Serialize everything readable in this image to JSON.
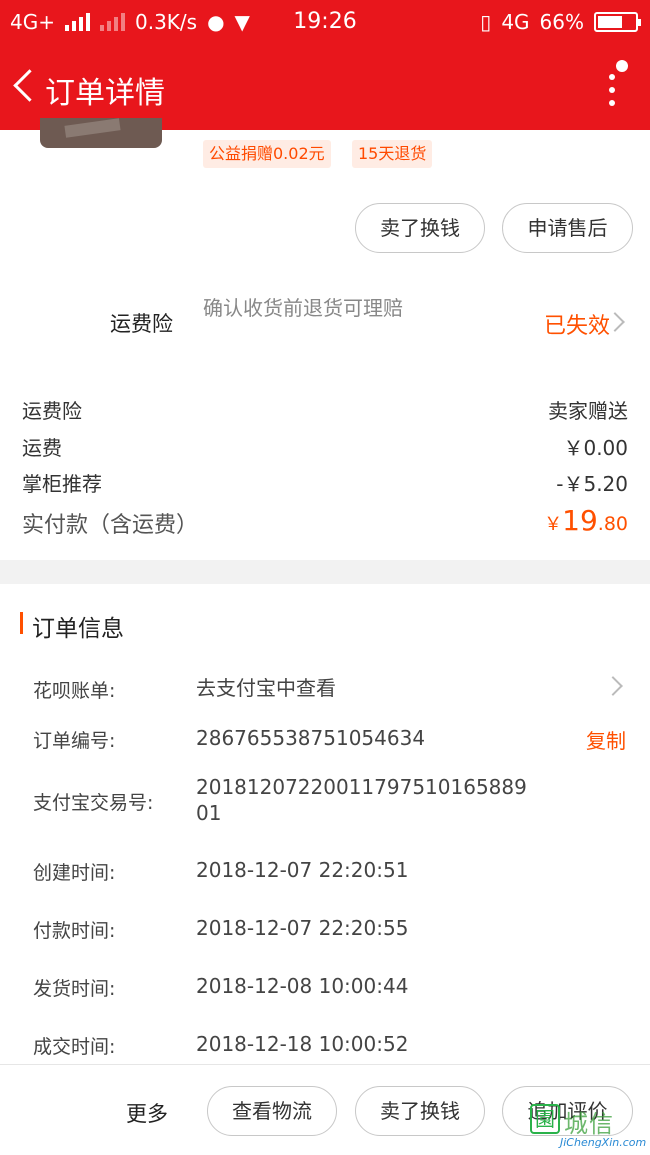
{
  "status_bar": {
    "network_left": "4G+",
    "speed": "0.3K/s",
    "time": "19:26",
    "network_right": "4G",
    "battery_percent": "66%",
    "battery_level": 0.66
  },
  "header": {
    "title": "订单详情",
    "accent_color": "#e8161c"
  },
  "product": {
    "tags": [
      "公益捐赠0.02元",
      "15天退货"
    ]
  },
  "actions_top": {
    "sell_label": "卖了换钱",
    "aftersale_label": "申请售后"
  },
  "shipping_insurance": {
    "label": "运费险",
    "description": "确认收货前退货可理赔",
    "status": "已失效"
  },
  "fees": [
    {
      "label": "运费险",
      "value": "卖家赠送"
    },
    {
      "label": "运费",
      "value": "￥0.00"
    },
    {
      "label": "掌柜推荐",
      "value": "-￥5.20"
    }
  ],
  "paid": {
    "label": "实付款（含运费）",
    "symbol": "￥",
    "integer": "19",
    "decimal": ".80"
  },
  "order_info": {
    "title": "订单信息",
    "huabei_label": "花呗账单:",
    "huabei_value": "去支付宝中查看",
    "order_no_label": "订单编号:",
    "order_no_value": "286765538751054634",
    "copy_label": "复制",
    "alipay_label": "支付宝交易号:",
    "alipay_value": "2018120722001179751016588901",
    "created_label": "创建时间:",
    "created_value": "2018-12-07 22:20:51",
    "paid_label": "付款时间:",
    "paid_value": "2018-12-07 22:20:55",
    "shipped_label": "发货时间:",
    "shipped_value": "2018-12-08 10:00:44",
    "completed_label": "成交时间:",
    "completed_value": "2018-12-18 10:00:52"
  },
  "bottom_bar": {
    "more_label": "更多",
    "logistics_label": "查看物流",
    "sell_label": "卖了换钱",
    "review_label": "追加评价"
  },
  "watermark": {
    "brand": "城信",
    "url": "JiChengXin.com"
  }
}
